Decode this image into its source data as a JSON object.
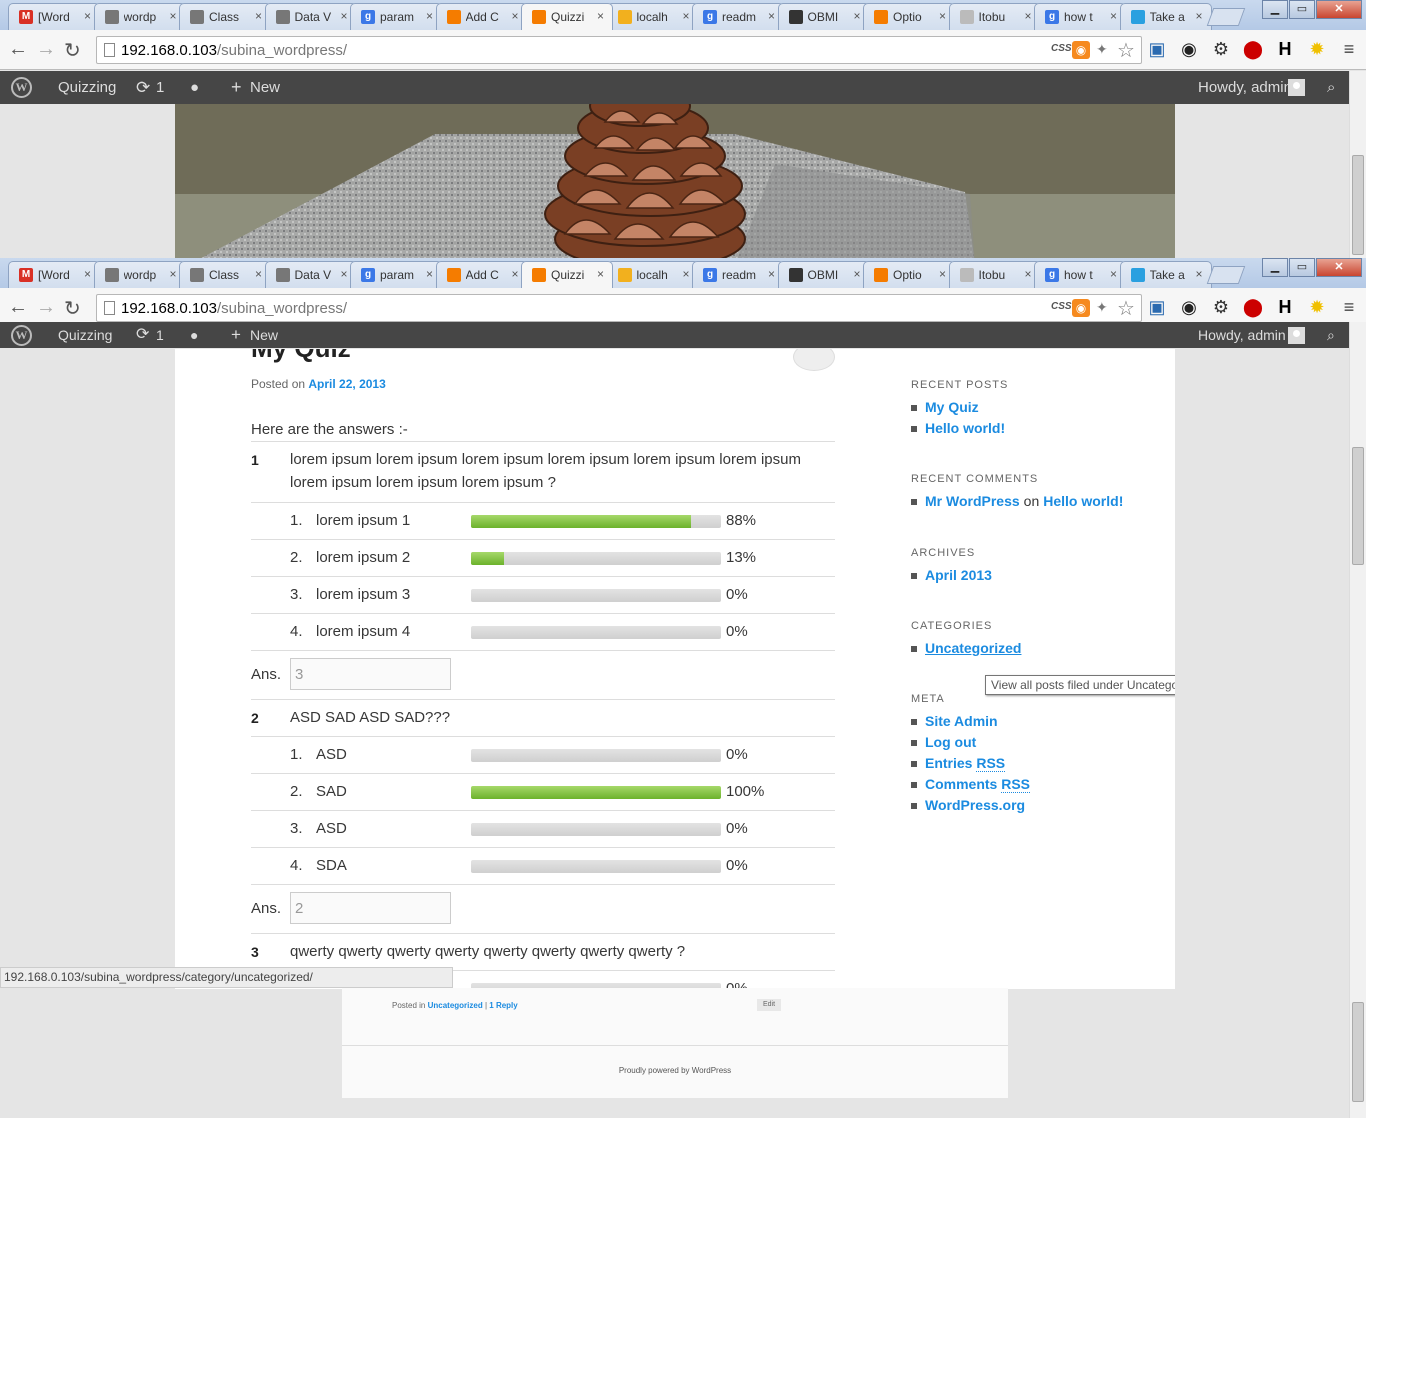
{
  "browser": {
    "tabs": [
      {
        "label": "[Word",
        "icon": "gmail-icon",
        "color": "#d93025"
      },
      {
        "label": "wordp",
        "icon": "wordpress-icon",
        "color": "#777777"
      },
      {
        "label": "Class",
        "icon": "wordpress-icon",
        "color": "#777777"
      },
      {
        "label": "Data V",
        "icon": "wordpress-icon",
        "color": "#777777"
      },
      {
        "label": "param",
        "icon": "google-search-icon",
        "color": "#3b78e7"
      },
      {
        "label": "Add C",
        "icon": "xampp-icon",
        "color": "#f57c00"
      },
      {
        "label": "Quizzi",
        "icon": "xampp-icon",
        "color": "#f57c00"
      },
      {
        "label": "localh",
        "icon": "phpmyadmin-icon",
        "color": "#f2b01e"
      },
      {
        "label": "readm",
        "icon": "google-search-icon",
        "color": "#3b78e7"
      },
      {
        "label": "OBMI",
        "icon": "github-icon",
        "color": "#333333"
      },
      {
        "label": "Optio",
        "icon": "xampp-icon",
        "color": "#f57c00"
      },
      {
        "label": "Itobu",
        "icon": "page-icon",
        "color": "#bbbbbb"
      },
      {
        "label": "how t",
        "icon": "google-search-icon",
        "color": "#3b78e7"
      },
      {
        "label": "Take a",
        "icon": "windows-icon",
        "color": "#2aa0e0"
      }
    ],
    "active_tab_index": 6,
    "close_glyph": "×",
    "url_host": "192.168.0.103",
    "url_path": "/subina_wordpress/",
    "css_badge": "CSS"
  },
  "adminbar": {
    "site_name": "Quizzing",
    "updates_count": "1",
    "new_label": "New",
    "howdy": "Howdy, admin"
  },
  "post": {
    "title": "My Quiz",
    "posted_on_prefix": "Posted on",
    "date": "April 22, 2013",
    "intro": "Here are the answers :-",
    "answer_prefix": "Ans.",
    "questions": [
      {
        "number": "1",
        "text": "lorem ipsum lorem ipsum lorem ipsum lorem ipsum lorem ipsum lorem ipsum lorem ipsum lorem ipsum lorem ipsum ?",
        "options": [
          {
            "num": "1.",
            "label": "lorem ipsum 1",
            "percent": 88,
            "percent_label": "88%"
          },
          {
            "num": "2.",
            "label": "lorem ipsum 2",
            "percent": 13,
            "percent_label": "13%"
          },
          {
            "num": "3.",
            "label": "lorem ipsum 3",
            "percent": 0,
            "percent_label": "0%"
          },
          {
            "num": "4.",
            "label": "lorem ipsum 4",
            "percent": 0,
            "percent_label": "0%"
          }
        ],
        "answer": "3"
      },
      {
        "number": "2",
        "text": "ASD SAD ASD SAD???",
        "options": [
          {
            "num": "1.",
            "label": "ASD",
            "percent": 0,
            "percent_label": "0%"
          },
          {
            "num": "2.",
            "label": "SAD",
            "percent": 100,
            "percent_label": "100%"
          },
          {
            "num": "3.",
            "label": "ASD",
            "percent": 0,
            "percent_label": "0%"
          },
          {
            "num": "4.",
            "label": "SDA",
            "percent": 0,
            "percent_label": "0%"
          }
        ],
        "answer": "2"
      },
      {
        "number": "3",
        "text": "qwerty qwerty qwerty qwerty qwerty qwerty qwerty qwerty ?",
        "options": [
          {
            "num": "",
            "label": "",
            "percent": 0,
            "percent_label": "0%"
          }
        ]
      }
    ]
  },
  "sidebar": {
    "recent_posts_title": "RECENT POSTS",
    "recent_posts": [
      "My Quiz",
      "Hello world!"
    ],
    "recent_comments_title": "RECENT COMMENTS",
    "recent_comment": {
      "author": "Mr WordPress",
      "on": "on",
      "post": "Hello world!"
    },
    "archives_title": "ARCHIVES",
    "archives": [
      "April 2013"
    ],
    "categories_title": "CATEGORIES",
    "categories": [
      "Uncategorized"
    ],
    "meta_title": "META",
    "meta": [
      {
        "label": "Site Admin",
        "abbr": ""
      },
      {
        "label": "Log out",
        "abbr": ""
      },
      {
        "label": "Entries ",
        "abbr": "RSS"
      },
      {
        "label": "Comments ",
        "abbr": "RSS"
      },
      {
        "label": "WordPress.org",
        "abbr": ""
      }
    ],
    "tooltip": "View all posts filed under Uncategorized"
  },
  "status_url": "192.168.0.103/subina_wordpress/category/uncategorized/",
  "footer": {
    "posted_in": "Posted in",
    "category": "Uncategorized",
    "separator": "|",
    "reply": "1 Reply",
    "edit": "Edit",
    "powered": "Proudly powered by WordPress"
  }
}
